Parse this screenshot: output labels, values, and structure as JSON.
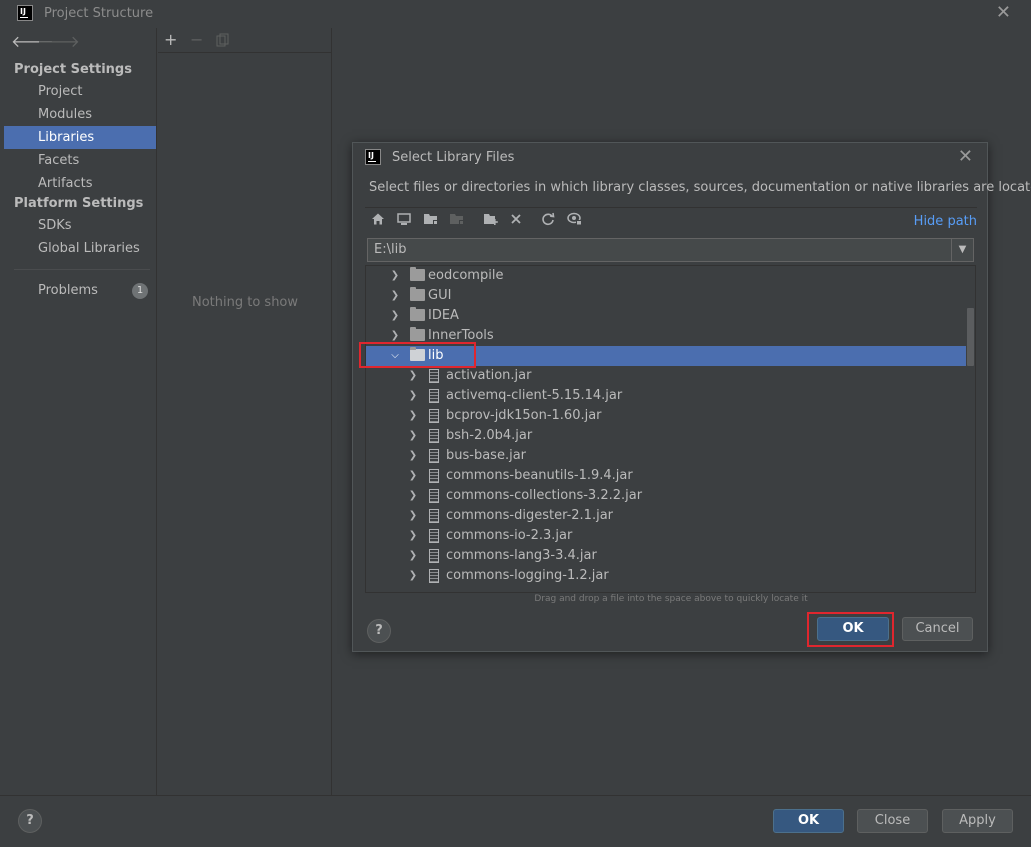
{
  "window": {
    "title": "Project Structure"
  },
  "sidebar": {
    "project_settings_label": "Project Settings",
    "platform_settings_label": "Platform Settings",
    "items": [
      {
        "label": "Project"
      },
      {
        "label": "Modules"
      },
      {
        "label": "Libraries",
        "selected": true
      },
      {
        "label": "Facets"
      },
      {
        "label": "Artifacts"
      },
      {
        "label": "SDKs"
      },
      {
        "label": "Global Libraries"
      },
      {
        "label": "Problems",
        "badge": "1"
      }
    ]
  },
  "middle": {
    "empty_text": "Nothing to show"
  },
  "dialog": {
    "title": "Select Library Files",
    "description": "Select files or directories in which library classes, sources, documentation or native libraries are located",
    "hide_path_label": "Hide path",
    "path_value": "E:\\lib",
    "tree": [
      {
        "label": "eodcompile",
        "type": "folder",
        "expanded": false
      },
      {
        "label": "GUI",
        "type": "folder",
        "expanded": false
      },
      {
        "label": "IDEA",
        "type": "folder",
        "expanded": false
      },
      {
        "label": "InnerTools",
        "type": "folder",
        "expanded": false
      },
      {
        "label": "lib",
        "type": "folder",
        "expanded": true,
        "selected": true
      },
      {
        "label": "activation.jar",
        "type": "jar"
      },
      {
        "label": "activemq-client-5.15.14.jar",
        "type": "jar"
      },
      {
        "label": "bcprov-jdk15on-1.60.jar",
        "type": "jar"
      },
      {
        "label": "bsh-2.0b4.jar",
        "type": "jar"
      },
      {
        "label": "bus-base.jar",
        "type": "jar"
      },
      {
        "label": "commons-beanutils-1.9.4.jar",
        "type": "jar"
      },
      {
        "label": "commons-collections-3.2.2.jar",
        "type": "jar"
      },
      {
        "label": "commons-digester-2.1.jar",
        "type": "jar"
      },
      {
        "label": "commons-io-2.3.jar",
        "type": "jar"
      },
      {
        "label": "commons-lang3-3.4.jar",
        "type": "jar"
      },
      {
        "label": "commons-logging-1.2.jar",
        "type": "jar"
      }
    ],
    "drag_hint": "Drag and drop a file into the space above to quickly locate it",
    "ok_label": "OK",
    "cancel_label": "Cancel"
  },
  "footer": {
    "ok_label": "OK",
    "close_label": "Close",
    "apply_label": "Apply"
  },
  "colors": {
    "selection": "#4b6eaf",
    "primary_button": "#365880",
    "link": "#589df6",
    "highlight_box": "#e0262e"
  }
}
